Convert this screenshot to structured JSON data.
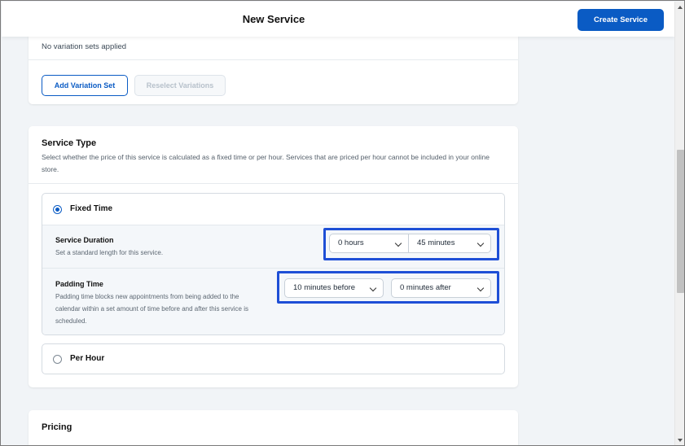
{
  "header": {
    "title": "New Service",
    "create_label": "Create Service"
  },
  "variations": {
    "empty_text": "No variation sets applied",
    "add_label": "Add Variation Set",
    "reselect_label": "Reselect Variations"
  },
  "service_type": {
    "title": "Service Type",
    "description_line1": "Select whether the price of this service is calculated as a fixed time or per hour. Services that are priced per hour cannot be included in your online",
    "description_line2": "store.",
    "fixed_time": {
      "label": "Fixed Time",
      "selected": true,
      "duration": {
        "title": "Service Duration",
        "description": "Set a standard length for this service.",
        "hours_value": "0 hours",
        "minutes_value": "45 minutes"
      },
      "padding": {
        "title": "Padding Time",
        "description_line1": "Padding time blocks new appointments from being added to the",
        "description_line2": "calendar within a set amount of time before and after this service is",
        "description_line3": "scheduled.",
        "before_value": "10 minutes before",
        "after_value": "0 minutes after"
      }
    },
    "per_hour": {
      "label": "Per Hour",
      "selected": false
    }
  },
  "pricing": {
    "title": "Pricing"
  },
  "colors": {
    "accent": "#0a5bc4",
    "highlight": "#1e4fd6",
    "background": "#f1f4f7"
  }
}
